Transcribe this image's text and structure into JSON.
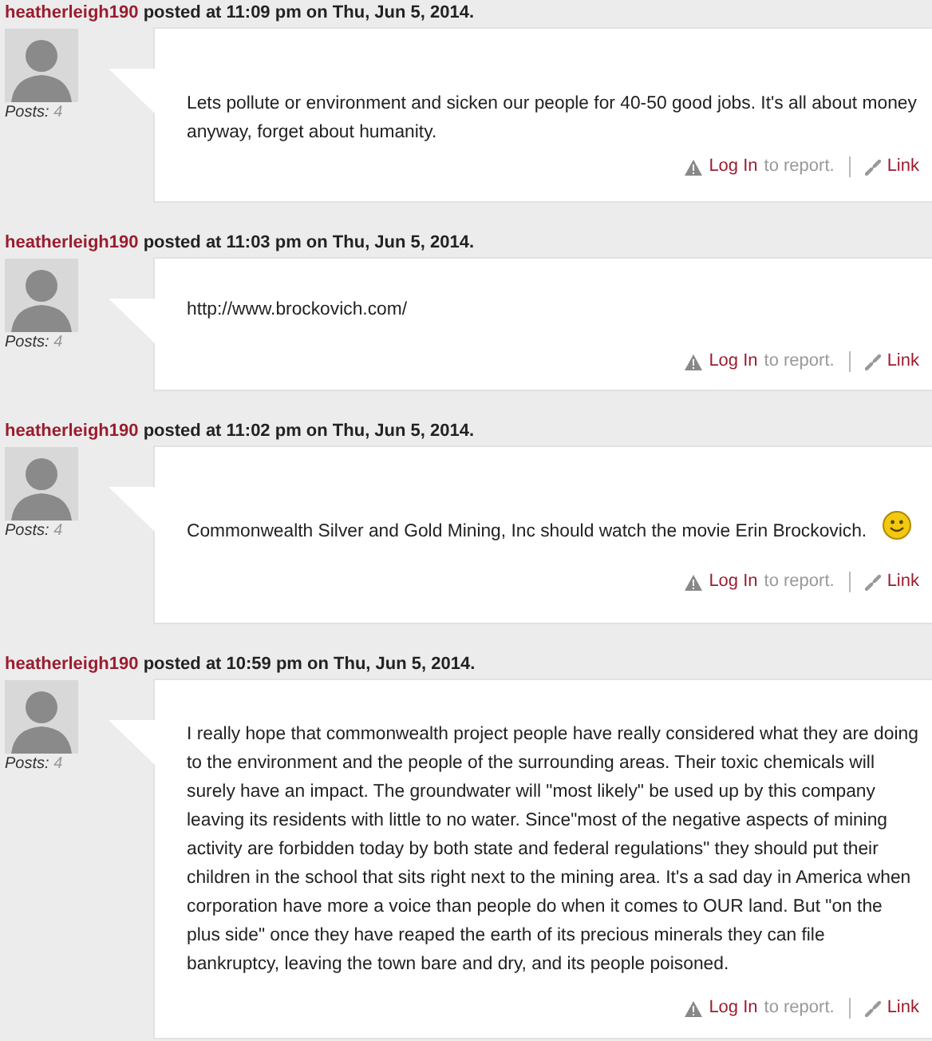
{
  "posts": [
    {
      "author": "heatherleigh190",
      "meta": "posted at 11:09 pm on Thu, Jun 5, 2014.",
      "posts_label": "Posts:",
      "posts_count": "4",
      "body": "Lets pollute or environment and sicken our people for 40-50 good jobs. It's all about money anyway, forget about humanity.",
      "smiley": false,
      "login_link": "Log In",
      "report_text": "to report.",
      "permalink": "Link"
    },
    {
      "author": "heatherleigh190",
      "meta": "posted at 11:03 pm on Thu, Jun 5, 2014.",
      "posts_label": "Posts:",
      "posts_count": "4",
      "body": "http://www.brockovich.com/",
      "smiley": false,
      "login_link": "Log In",
      "report_text": "to report.",
      "permalink": "Link"
    },
    {
      "author": "heatherleigh190",
      "meta": "posted at 11:02 pm on Thu, Jun 5, 2014.",
      "posts_label": "Posts:",
      "posts_count": "4",
      "body": "Commonwealth Silver and Gold Mining, Inc should watch the movie Erin Brockovich.",
      "smiley": true,
      "login_link": "Log In",
      "report_text": "to report.",
      "permalink": "Link"
    },
    {
      "author": "heatherleigh190",
      "meta": "posted at 10:59 pm on Thu, Jun 5, 2014.",
      "posts_label": "Posts:",
      "posts_count": "4",
      "body": "I really hope that commonwealth project people have really considered what they are doing to the environment and the people of the surrounding areas. Their toxic chemicals will surely have an impact. The groundwater will \"most likely\" be used up by this company leaving its residents with little to no water. Since\"most of the negative aspects of mining activity are forbidden today by both state and federal regulations\" they should put their children in the school that sits right next to the mining area. It's a sad day in America when corporation have more a voice than people do when it comes to OUR land. But \"on the plus side\" once they have reaped the earth of its precious minerals they can file bankruptcy, leaving the town bare and dry, and its people poisoned.",
      "smiley": false,
      "login_link": "Log In",
      "report_text": "to report.",
      "permalink": "Link"
    }
  ]
}
